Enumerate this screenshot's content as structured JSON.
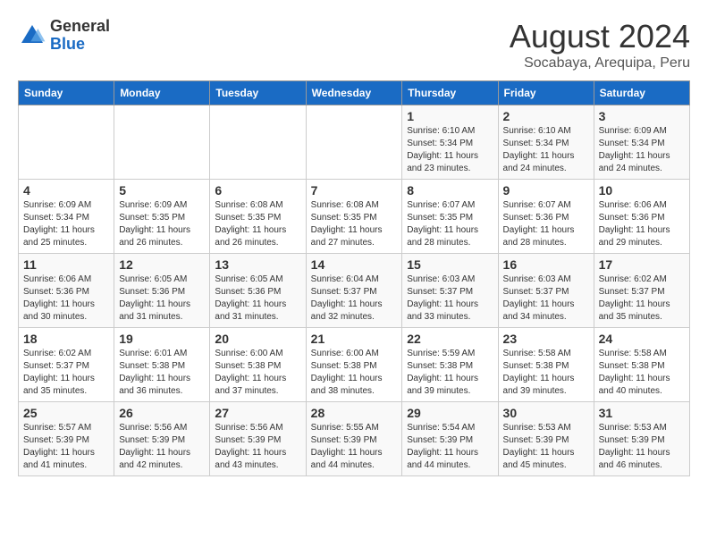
{
  "logo": {
    "line1": "General",
    "line2": "Blue"
  },
  "title": "August 2024",
  "subtitle": "Socabaya, Arequipa, Peru",
  "days_of_week": [
    "Sunday",
    "Monday",
    "Tuesday",
    "Wednesday",
    "Thursday",
    "Friday",
    "Saturday"
  ],
  "weeks": [
    [
      {
        "day": "",
        "info": ""
      },
      {
        "day": "",
        "info": ""
      },
      {
        "day": "",
        "info": ""
      },
      {
        "day": "",
        "info": ""
      },
      {
        "day": "1",
        "info": "Sunrise: 6:10 AM\nSunset: 5:34 PM\nDaylight: 11 hours and 23 minutes."
      },
      {
        "day": "2",
        "info": "Sunrise: 6:10 AM\nSunset: 5:34 PM\nDaylight: 11 hours and 24 minutes."
      },
      {
        "day": "3",
        "info": "Sunrise: 6:09 AM\nSunset: 5:34 PM\nDaylight: 11 hours and 24 minutes."
      }
    ],
    [
      {
        "day": "4",
        "info": "Sunrise: 6:09 AM\nSunset: 5:34 PM\nDaylight: 11 hours and 25 minutes."
      },
      {
        "day": "5",
        "info": "Sunrise: 6:09 AM\nSunset: 5:35 PM\nDaylight: 11 hours and 26 minutes."
      },
      {
        "day": "6",
        "info": "Sunrise: 6:08 AM\nSunset: 5:35 PM\nDaylight: 11 hours and 26 minutes."
      },
      {
        "day": "7",
        "info": "Sunrise: 6:08 AM\nSunset: 5:35 PM\nDaylight: 11 hours and 27 minutes."
      },
      {
        "day": "8",
        "info": "Sunrise: 6:07 AM\nSunset: 5:35 PM\nDaylight: 11 hours and 28 minutes."
      },
      {
        "day": "9",
        "info": "Sunrise: 6:07 AM\nSunset: 5:36 PM\nDaylight: 11 hours and 28 minutes."
      },
      {
        "day": "10",
        "info": "Sunrise: 6:06 AM\nSunset: 5:36 PM\nDaylight: 11 hours and 29 minutes."
      }
    ],
    [
      {
        "day": "11",
        "info": "Sunrise: 6:06 AM\nSunset: 5:36 PM\nDaylight: 11 hours and 30 minutes."
      },
      {
        "day": "12",
        "info": "Sunrise: 6:05 AM\nSunset: 5:36 PM\nDaylight: 11 hours and 31 minutes."
      },
      {
        "day": "13",
        "info": "Sunrise: 6:05 AM\nSunset: 5:36 PM\nDaylight: 11 hours and 31 minutes."
      },
      {
        "day": "14",
        "info": "Sunrise: 6:04 AM\nSunset: 5:37 PM\nDaylight: 11 hours and 32 minutes."
      },
      {
        "day": "15",
        "info": "Sunrise: 6:03 AM\nSunset: 5:37 PM\nDaylight: 11 hours and 33 minutes."
      },
      {
        "day": "16",
        "info": "Sunrise: 6:03 AM\nSunset: 5:37 PM\nDaylight: 11 hours and 34 minutes."
      },
      {
        "day": "17",
        "info": "Sunrise: 6:02 AM\nSunset: 5:37 PM\nDaylight: 11 hours and 35 minutes."
      }
    ],
    [
      {
        "day": "18",
        "info": "Sunrise: 6:02 AM\nSunset: 5:37 PM\nDaylight: 11 hours and 35 minutes."
      },
      {
        "day": "19",
        "info": "Sunrise: 6:01 AM\nSunset: 5:38 PM\nDaylight: 11 hours and 36 minutes."
      },
      {
        "day": "20",
        "info": "Sunrise: 6:00 AM\nSunset: 5:38 PM\nDaylight: 11 hours and 37 minutes."
      },
      {
        "day": "21",
        "info": "Sunrise: 6:00 AM\nSunset: 5:38 PM\nDaylight: 11 hours and 38 minutes."
      },
      {
        "day": "22",
        "info": "Sunrise: 5:59 AM\nSunset: 5:38 PM\nDaylight: 11 hours and 39 minutes."
      },
      {
        "day": "23",
        "info": "Sunrise: 5:58 AM\nSunset: 5:38 PM\nDaylight: 11 hours and 39 minutes."
      },
      {
        "day": "24",
        "info": "Sunrise: 5:58 AM\nSunset: 5:38 PM\nDaylight: 11 hours and 40 minutes."
      }
    ],
    [
      {
        "day": "25",
        "info": "Sunrise: 5:57 AM\nSunset: 5:39 PM\nDaylight: 11 hours and 41 minutes."
      },
      {
        "day": "26",
        "info": "Sunrise: 5:56 AM\nSunset: 5:39 PM\nDaylight: 11 hours and 42 minutes."
      },
      {
        "day": "27",
        "info": "Sunrise: 5:56 AM\nSunset: 5:39 PM\nDaylight: 11 hours and 43 minutes."
      },
      {
        "day": "28",
        "info": "Sunrise: 5:55 AM\nSunset: 5:39 PM\nDaylight: 11 hours and 44 minutes."
      },
      {
        "day": "29",
        "info": "Sunrise: 5:54 AM\nSunset: 5:39 PM\nDaylight: 11 hours and 44 minutes."
      },
      {
        "day": "30",
        "info": "Sunrise: 5:53 AM\nSunset: 5:39 PM\nDaylight: 11 hours and 45 minutes."
      },
      {
        "day": "31",
        "info": "Sunrise: 5:53 AM\nSunset: 5:39 PM\nDaylight: 11 hours and 46 minutes."
      }
    ]
  ]
}
